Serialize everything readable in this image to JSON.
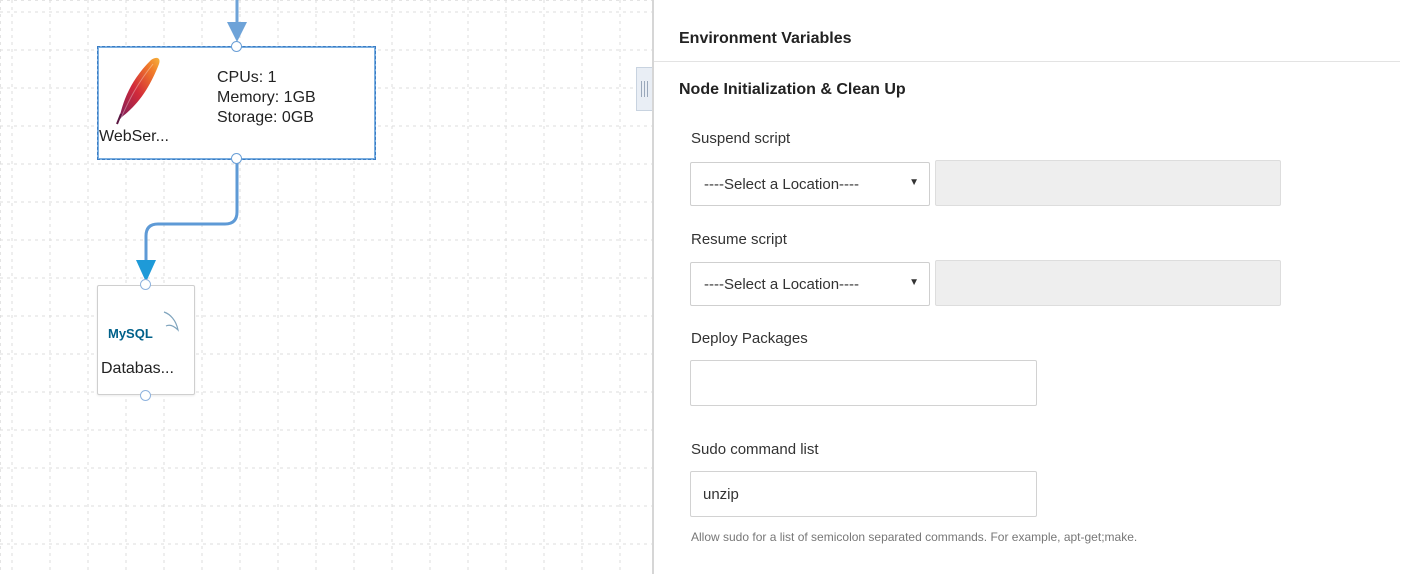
{
  "canvas": {
    "nodes": {
      "webserver": {
        "label": "WebSer...",
        "cpus": "CPUs: 1",
        "memory": "Memory: 1GB",
        "storage": "Storage: 0GB",
        "icon": "feather-icon"
      },
      "database": {
        "label": "Databas...",
        "icon": "mysql-logo",
        "logo_text": "MySQL"
      }
    }
  },
  "panel": {
    "sections": {
      "env": "Environment Variables",
      "node_init": "Node Initialization & Clean Up"
    },
    "suspend": {
      "label": "Suspend script",
      "select_value": "----Select a Location----"
    },
    "resume": {
      "label": "Resume script",
      "select_value": "----Select a Location----"
    },
    "deploy": {
      "label": "Deploy Packages",
      "value": ""
    },
    "sudo": {
      "label": "Sudo command list",
      "value": "unzip",
      "help": "Allow sudo for a list of semicolon separated commands. For example, apt-get;make."
    }
  },
  "colors": {
    "connector": "#3f8fd6",
    "selection": "#3a7cc4",
    "disabled_field": "#eeeeee"
  }
}
